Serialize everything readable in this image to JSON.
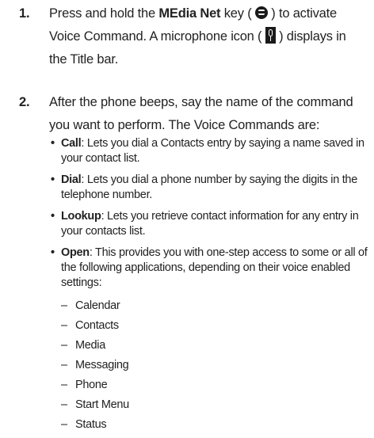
{
  "step1": {
    "number": "1.",
    "t1": "Press and hold the ",
    "key_name": "MEdia Net",
    "t2": " key ( ",
    "t3": " ) to activate Voice Command. A microphone icon ( ",
    "t4": " ) displays in the Title bar."
  },
  "step2": {
    "number": "2.",
    "text": "After the phone beeps, say the name of the command you want to perform. The Voice Commands are:"
  },
  "commands": [
    {
      "name": "Call",
      "desc": ": Lets you dial a Contacts entry by saying a name saved in your contact list."
    },
    {
      "name": "Dial",
      "desc": ": Lets you dial a phone number by saying the digits in the telephone number."
    },
    {
      "name": "Lookup",
      "desc": ": Lets you retrieve contact information for any entry in your contacts list."
    },
    {
      "name": "Open",
      "desc": ": This provides you with one-step access to some or all of the following applications, depending on their voice enabled settings:"
    }
  ],
  "applications": [
    "Calendar",
    "Contacts",
    "Media",
    "Messaging",
    "Phone",
    "Start Menu",
    "Status"
  ],
  "icons": {
    "media_net_key": "media-net-key-icon",
    "microphone": "microphone-icon"
  }
}
